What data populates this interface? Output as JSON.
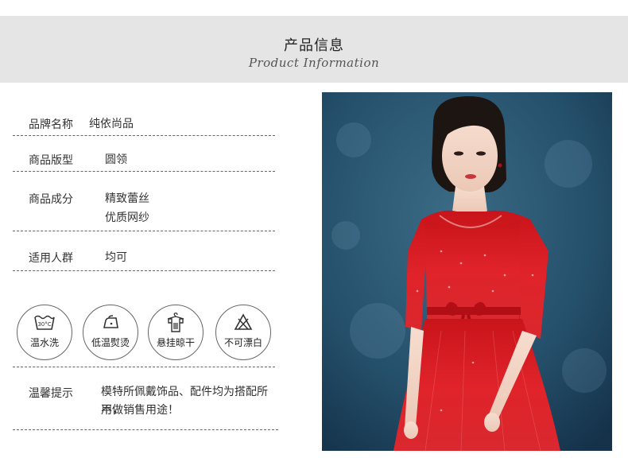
{
  "header": {
    "title": "产品信息",
    "subtitle": "Product Information"
  },
  "specs": [
    {
      "label": "品牌名称",
      "value": [
        "纯依尚品"
      ]
    },
    {
      "label": "商品版型",
      "value": [
        "圆领"
      ]
    },
    {
      "label": "商品成分",
      "value": [
        "精致蕾丝",
        "优质网纱"
      ]
    },
    {
      "label": "适用人群",
      "value": [
        "均可"
      ]
    }
  ],
  "care": [
    {
      "icon": "wash-30-icon",
      "label": "温水洗"
    },
    {
      "icon": "low-iron-icon",
      "label": "低温熨烫"
    },
    {
      "icon": "hang-dry-icon",
      "label": "悬挂晾干"
    },
    {
      "icon": "no-bleach-icon",
      "label": "不可漂白"
    }
  ],
  "tips": {
    "label": "温馨提示",
    "lines": [
      "模特所佩戴饰品、配件均为搭配所用，",
      "不做销售用途！"
    ]
  },
  "colors": {
    "header_bg": "#e5e5e5",
    "dress_red": "#d8191c",
    "backdrop": "#2a5068"
  }
}
